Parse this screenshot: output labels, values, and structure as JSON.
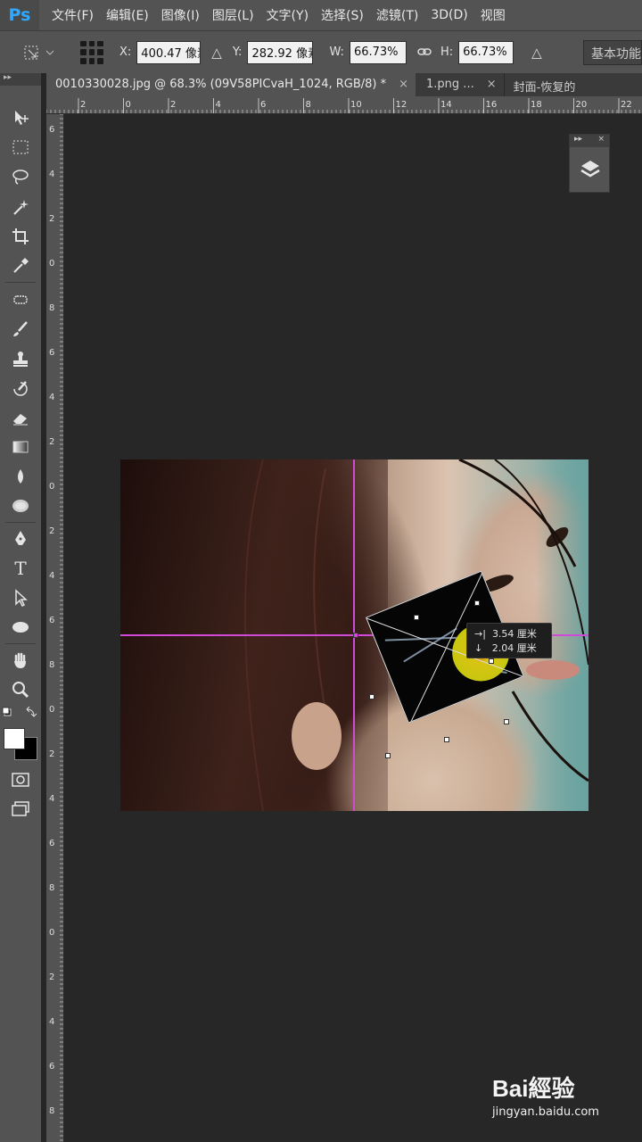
{
  "app": {
    "logo_text": "Ps"
  },
  "menu": {
    "items": [
      "文件(F)",
      "编辑(E)",
      "图像(I)",
      "图层(L)",
      "文字(Y)",
      "选择(S)",
      "滤镜(T)",
      "3D(D)",
      "视图"
    ]
  },
  "options": {
    "x_label": "X:",
    "x_value": "400.47 像素",
    "delta_symbol": "△",
    "y_label": "Y:",
    "y_value": "282.92 像素",
    "w_label": "W:",
    "w_value": "66.73%",
    "h_label": "H:",
    "h_value": "66.73%",
    "angle_symbol": "△",
    "workspace": "基本功能"
  },
  "tabs": [
    {
      "label": "0010330028.jpg @ 68.3% (09V58PICvaH_1024, RGB/8) *",
      "close": "×",
      "active": true
    },
    {
      "label": "1.png ...",
      "close": "×",
      "active": false
    },
    {
      "label": "封面-恢复的",
      "close": "",
      "active": false
    }
  ],
  "ruler_h_labels": [
    "2",
    "0",
    "2",
    "4",
    "6",
    "8",
    "10",
    "12",
    "14",
    "16",
    "18",
    "20",
    "22"
  ],
  "ruler_v_labels": [
    "6",
    "4",
    "2",
    "0",
    "8",
    "6",
    "4",
    "2",
    "0",
    "2",
    "4",
    "6",
    "8",
    "0",
    "2",
    "4",
    "6",
    "8",
    "0",
    "2",
    "4",
    "6",
    "8",
    "0"
  ],
  "tooltip": {
    "line1_symbol": "→|",
    "line1_value": "3.54 厘米",
    "line2_symbol": "↓",
    "line2_value": "2.04 厘米"
  },
  "float_panel": {
    "collapse": "▸▸",
    "close": "×"
  },
  "watermark": {
    "logo": "Bai經验",
    "url": "jingyan.baidu.com"
  },
  "colors": {
    "menu_bg": "#535353",
    "canvas_bg": "#272727",
    "guide": "#d049d8",
    "accent": "#31a8ff"
  }
}
